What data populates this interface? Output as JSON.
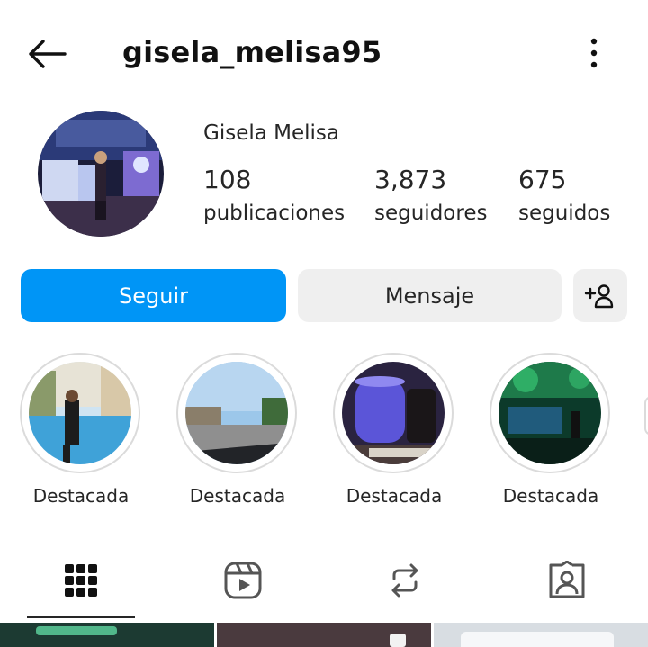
{
  "header": {
    "username": "gisela_melisa95",
    "back_icon": "arrow-left-icon",
    "more_icon": "vertical-dots-icon"
  },
  "profile": {
    "full_name": "Gisela Melisa",
    "stats": [
      {
        "value": "108",
        "label": "publicaciones"
      },
      {
        "value": "3,873",
        "label": "seguidores"
      },
      {
        "value": "675",
        "label": "seguidos"
      }
    ]
  },
  "actions": {
    "follow_label": "Seguir",
    "message_label": "Mensaje",
    "add_icon": "add-person-icon"
  },
  "highlights": [
    {
      "label": "Destacada"
    },
    {
      "label": "Destacada"
    },
    {
      "label": "Destacada"
    },
    {
      "label": "Destacada"
    }
  ],
  "tabs": [
    {
      "icon": "grid-icon",
      "active": true
    },
    {
      "icon": "reels-icon",
      "active": false
    },
    {
      "icon": "repost-icon",
      "active": false
    },
    {
      "icon": "tagged-icon",
      "active": false
    }
  ],
  "colors": {
    "accent": "#0095f6",
    "secondary_button": "#efefef",
    "text": "#262626"
  }
}
